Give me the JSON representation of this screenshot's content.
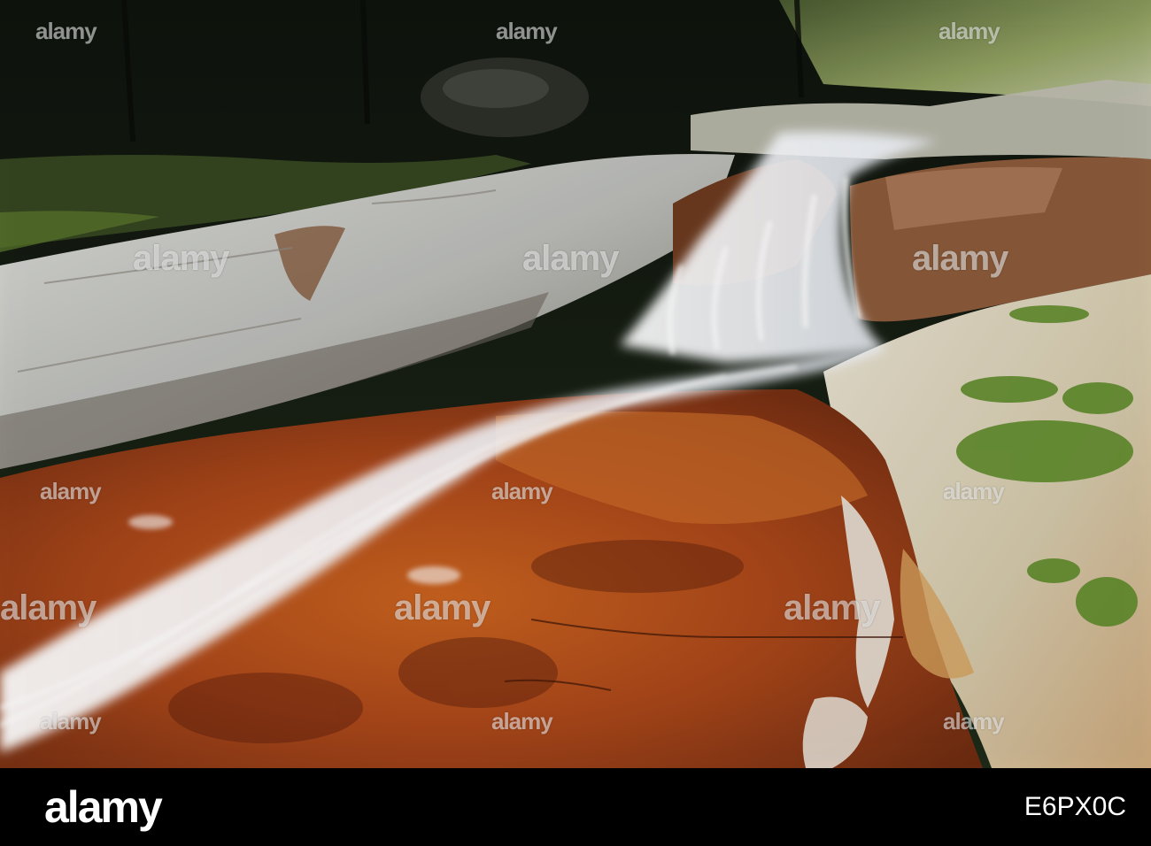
{
  "image": {
    "subject": "waterfall-photo"
  },
  "watermark": {
    "text": "alamy",
    "color": "#ffffff"
  },
  "banner": {
    "logo": "alamy",
    "image_id_label": "",
    "image_id": "E6PX0C",
    "background": "#000000",
    "text_color": "#ffffff"
  }
}
